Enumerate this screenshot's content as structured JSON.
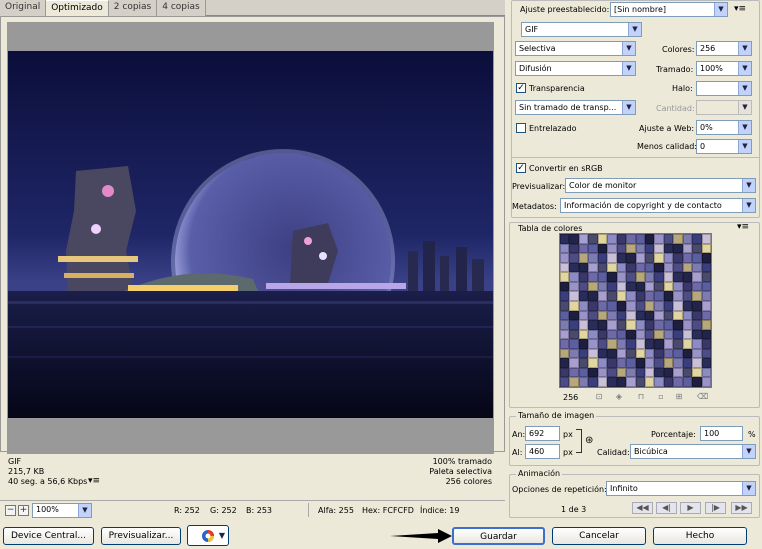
{
  "tabs": [
    "Original",
    "Optimizado",
    "2 copias",
    "4 copias"
  ],
  "info": {
    "format": "GIF",
    "size": "215,7 KB",
    "time": "40 seg. a 56,6 Kbps",
    "dither": "100% tramado",
    "palette": "Paleta selectiva",
    "colors": "256 colores"
  },
  "statusbar": {
    "zoom": "100%",
    "r": "R: 252",
    "g": "G: 252",
    "b": "B: 253",
    "alpha": "Alfa: 255",
    "hex": "Hex: FCFCFD",
    "index": "Índice: 19"
  },
  "buttons": {
    "device_central": "Device Central...",
    "preview": "Previsualizar...",
    "save": "Guardar",
    "cancel": "Cancelar",
    "done": "Hecho"
  },
  "settings": {
    "preset_label": "Ajuste preestablecido:",
    "preset_value": "[Sin nombre]",
    "format": "GIF",
    "reduction": "Selectiva",
    "colors_label": "Colores:",
    "colors_value": "256",
    "dither_algo": "Difusión",
    "dither_label": "Tramado:",
    "dither_value": "100%",
    "transparency_label": "Transparencia",
    "matte_label": "Halo:",
    "transp_dither": "Sin tramado de transp...",
    "amount_label": "Cantidad:",
    "interlaced_label": "Entrelazado",
    "websnap_label": "Ajuste a Web:",
    "websnap_value": "0%",
    "lossy_label": "Menos calidad:",
    "lossy_value": "0",
    "srgb_label": "Convertir en sRGB",
    "preview_label": "Previsualizar:",
    "preview_value": "Color de monitor",
    "metadata_label": "Metadatos:",
    "metadata_value": "Información de copyright y de contacto"
  },
  "color_table": {
    "title": "Tabla de colores",
    "count": "256",
    "colors": [
      "#2a2c5a",
      "#6e6aa8",
      "#3b3e7c",
      "#8d8bc4",
      "#b6a87a",
      "#4a4a6c",
      "#9993c8",
      "#23244a",
      "#5b5fa0",
      "#c9c0d8",
      "#3a3868",
      "#7d7bb0",
      "#e2d6a0",
      "#4e4c84",
      "#a79fcf",
      "#1e1f3e"
    ]
  },
  "image_size": {
    "title": "Tamaño de imagen",
    "w_label": "An:",
    "w_value": "692",
    "h_label": "Al:",
    "h_value": "460",
    "unit": "px",
    "pct_label": "Porcentaje:",
    "pct_value": "100",
    "pct_unit": "%",
    "quality_label": "Calidad:",
    "quality_value": "Bicúbica"
  },
  "animation": {
    "title": "Animación",
    "loop_label": "Opciones de repetición:",
    "loop_value": "Infinito",
    "frame": "1 de 3"
  }
}
